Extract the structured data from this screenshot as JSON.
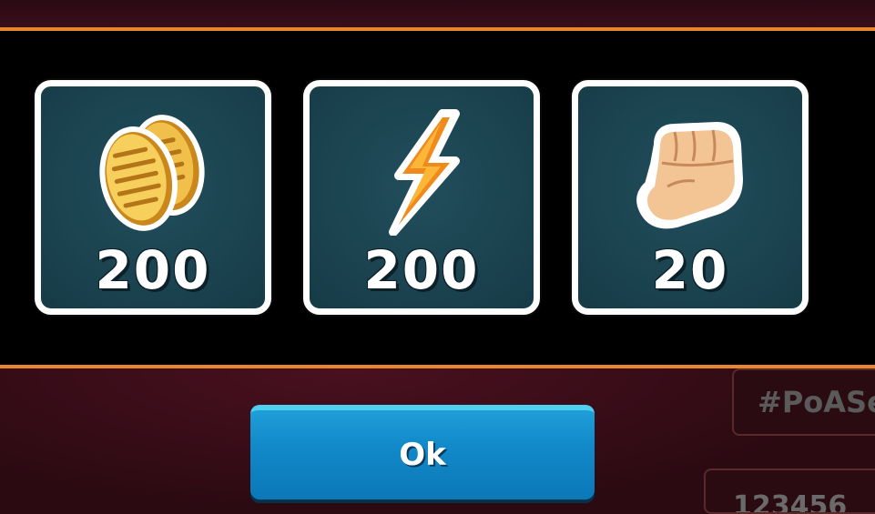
{
  "rewards": [
    {
      "icon": "gold-coins-icon",
      "amount": "200"
    },
    {
      "icon": "lightning-energy-icon",
      "amount": "200"
    },
    {
      "icon": "fist-power-icon",
      "amount": "20"
    }
  ],
  "ok_button": {
    "label": "Ok"
  },
  "side": {
    "hashtag_text": "#PoASe",
    "code_text": "123456"
  },
  "colors": {
    "accent_border": "#e8862e",
    "tile_bg": "#163b47",
    "button_blue": "#1289c9"
  }
}
